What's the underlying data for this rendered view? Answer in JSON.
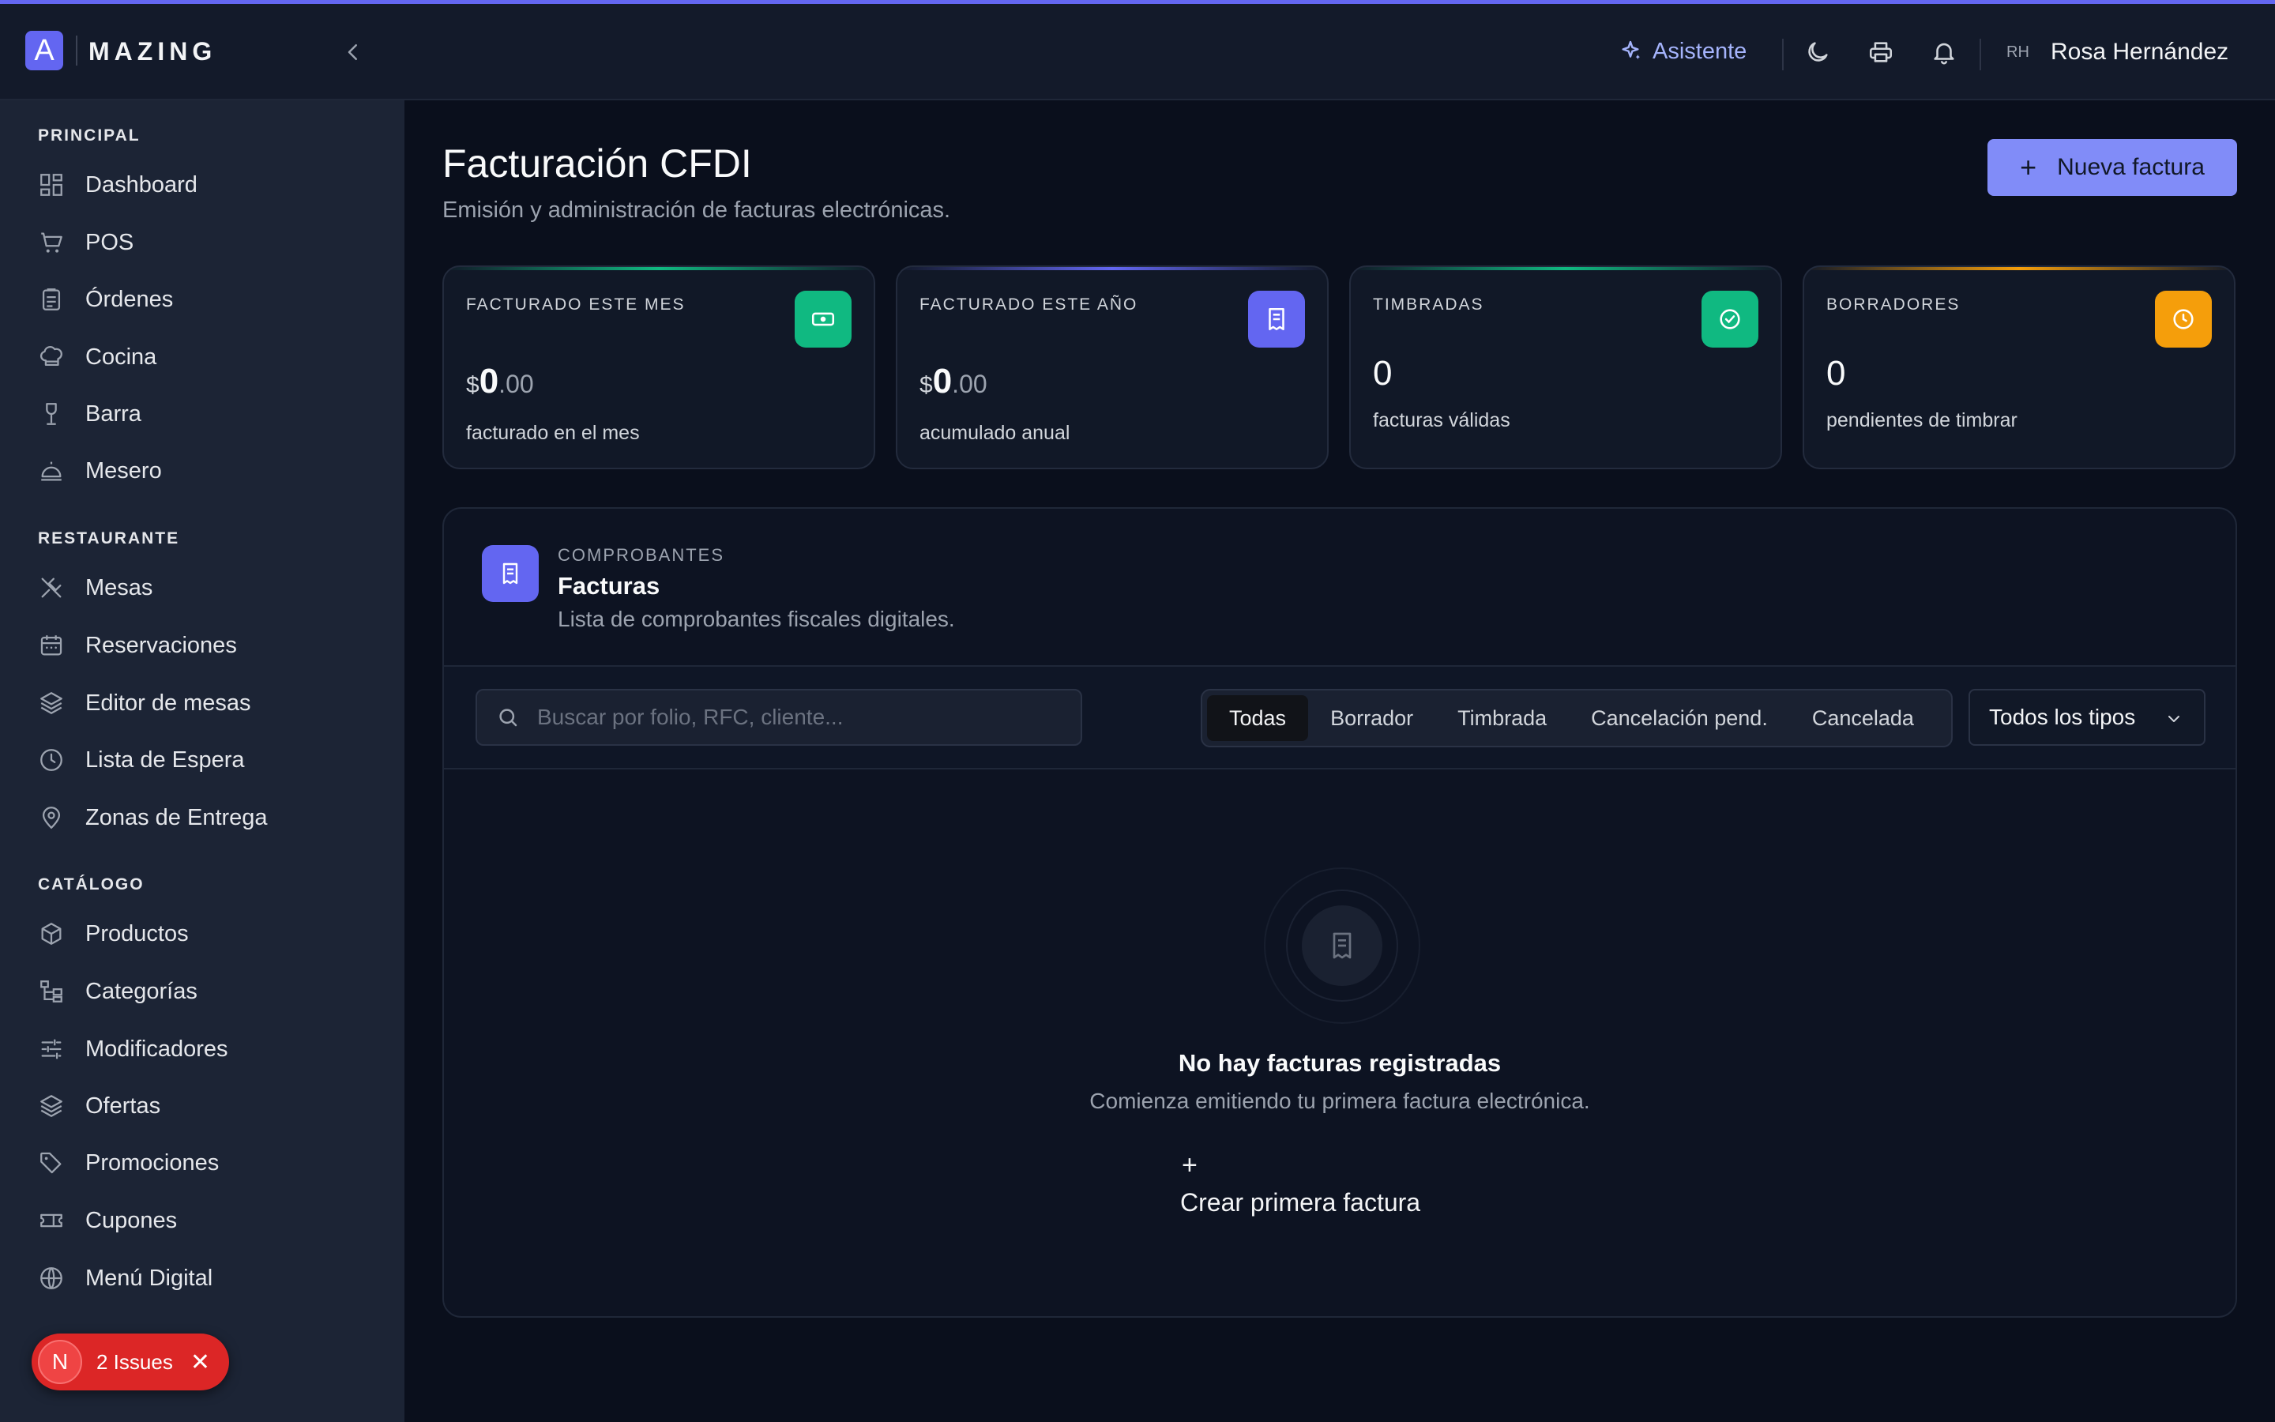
{
  "header": {
    "logo_letter": "A",
    "logo_text": "MAZING",
    "assistant_label": "Asistente",
    "user_initials": "RH",
    "user_name": "Rosa Hernández"
  },
  "sidebar": {
    "sections": [
      {
        "title": "PRINCIPAL",
        "items": [
          "Dashboard",
          "POS",
          "Órdenes",
          "Cocina",
          "Barra",
          "Mesero"
        ]
      },
      {
        "title": "RESTAURANTE",
        "items": [
          "Mesas",
          "Reservaciones",
          "Editor de mesas",
          "Lista de Espera",
          "Zonas de Entrega"
        ]
      },
      {
        "title": "CATÁLOGO",
        "items": [
          "Productos",
          "Categorías",
          "Modificadores",
          "Ofertas",
          "Promociones",
          "Cupones",
          "Menú Digital"
        ]
      }
    ],
    "issues_badge": {
      "letter": "N",
      "label": "2 Issues"
    }
  },
  "page": {
    "title": "Facturación CFDI",
    "subtitle": "Emisión y administración de facturas electrónicas.",
    "new_button": "Nueva factura"
  },
  "stats": [
    {
      "label": "FACTURADO ESTE MES",
      "currency": "$",
      "integer": "0",
      "decimals": ".00",
      "desc": "facturado en el mes",
      "color": "#10b981",
      "icon": "cash-icon"
    },
    {
      "label": "FACTURADO ESTE AÑO",
      "currency": "$",
      "integer": "0",
      "decimals": ".00",
      "desc": "acumulado anual",
      "color": "#6366f1",
      "icon": "receipt-icon"
    },
    {
      "label": "TIMBRADAS",
      "count": "0",
      "desc": "facturas válidas",
      "color": "#10b981",
      "icon": "check-circle-icon"
    },
    {
      "label": "BORRADORES",
      "count": "0",
      "desc": "pendientes de timbrar",
      "color": "#f59e0b",
      "icon": "clock-icon"
    }
  ],
  "panel": {
    "eyebrow": "COMPROBANTES",
    "title": "Facturas",
    "subtitle": "Lista de comprobantes fiscales digitales.",
    "search_placeholder": "Buscar por folio, RFC, cliente...",
    "tabs": [
      "Todas",
      "Borrador",
      "Timbrada",
      "Cancelación pend.",
      "Cancelada"
    ],
    "active_tab": "Todas",
    "type_filter": "Todos los tipos",
    "empty_title": "No hay facturas registradas",
    "empty_subtitle": "Comienza emitiendo tu primera factura electrónica.",
    "empty_button": "Crear primera factura"
  }
}
